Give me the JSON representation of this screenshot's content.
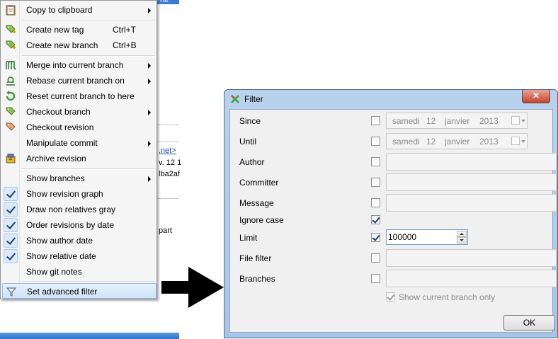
{
  "background": {
    "title_fragment": "nit log",
    "link_fragment": ".net>",
    "text_line1": "v. 12 1",
    "text_line2": "lba2af",
    "text_line3": "part"
  },
  "menu": {
    "items": [
      {
        "label": "Copy to clipboard",
        "shortcut": "",
        "submenu": true,
        "icon": "clipboard-icon",
        "checked": false
      },
      {
        "label": "Create new tag",
        "shortcut": "Ctrl+T",
        "submenu": false,
        "icon": "tag-add-icon",
        "checked": false
      },
      {
        "label": "Create new branch",
        "shortcut": "Ctrl+B",
        "submenu": false,
        "icon": "branch-add-icon",
        "checked": false
      },
      {
        "label": "Merge into current branch",
        "shortcut": "",
        "submenu": true,
        "icon": "merge-icon",
        "checked": false
      },
      {
        "label": "Rebase current branch on",
        "shortcut": "",
        "submenu": true,
        "icon": "rebase-icon",
        "checked": false
      },
      {
        "label": "Reset current branch to here",
        "shortcut": "",
        "submenu": false,
        "icon": "reset-icon",
        "checked": false
      },
      {
        "label": "Checkout branch",
        "shortcut": "",
        "submenu": true,
        "icon": "checkout-branch-icon",
        "checked": false
      },
      {
        "label": "Checkout revision",
        "shortcut": "",
        "submenu": false,
        "icon": "checkout-revision-icon",
        "checked": false
      },
      {
        "label": "Manipulate commit",
        "shortcut": "",
        "submenu": true,
        "icon": "",
        "checked": false
      },
      {
        "label": "Archive revision",
        "shortcut": "",
        "submenu": false,
        "icon": "archive-icon",
        "checked": false
      },
      {
        "label": "Show branches",
        "shortcut": "",
        "submenu": true,
        "icon": "",
        "checked": false
      },
      {
        "label": "Show revision graph",
        "shortcut": "",
        "submenu": false,
        "icon": "",
        "checked": true
      },
      {
        "label": "Draw non relatives gray",
        "shortcut": "",
        "submenu": false,
        "icon": "",
        "checked": true
      },
      {
        "label": "Order revisions by date",
        "shortcut": "",
        "submenu": false,
        "icon": "",
        "checked": true
      },
      {
        "label": "Show author date",
        "shortcut": "",
        "submenu": false,
        "icon": "",
        "checked": true
      },
      {
        "label": "Show relative date",
        "shortcut": "",
        "submenu": false,
        "icon": "",
        "checked": true
      },
      {
        "label": "Show git notes",
        "shortcut": "",
        "submenu": false,
        "icon": "",
        "checked": false
      },
      {
        "label": "Set advanced filter",
        "shortcut": "",
        "submenu": false,
        "icon": "filter-icon",
        "checked": false
      }
    ]
  },
  "dialog": {
    "title": "Filter",
    "close_label": "✕",
    "since": {
      "label": "Since",
      "checked": false,
      "day_name": "samedi",
      "day": "12",
      "month": "janvier",
      "year": "2013"
    },
    "until": {
      "label": "Until",
      "checked": false,
      "day_name": "samedi",
      "day": "12",
      "month": "janvier",
      "year": "2013"
    },
    "author": {
      "label": "Author",
      "checked": false,
      "value": ""
    },
    "committer": {
      "label": "Committer",
      "checked": false,
      "value": ""
    },
    "message": {
      "label": "Message",
      "checked": false,
      "value": ""
    },
    "ignore_case": {
      "label": "Ignore case",
      "checked": true
    },
    "limit": {
      "label": "Limit",
      "checked": true,
      "value": "100000"
    },
    "file_filter": {
      "label": "File filter",
      "checked": false,
      "value": ""
    },
    "branches": {
      "label": "Branches",
      "checked": false,
      "value": ""
    },
    "show_current_branch_only": {
      "label": "Show current branch only",
      "checked": true,
      "enabled": false
    },
    "ok_label": "OK"
  },
  "colors": {
    "menu_bg": "#f5f5f5",
    "highlight": "#cfe3fa",
    "dialog_frame": "#b9d3ee",
    "close_button": "#c5452f"
  }
}
